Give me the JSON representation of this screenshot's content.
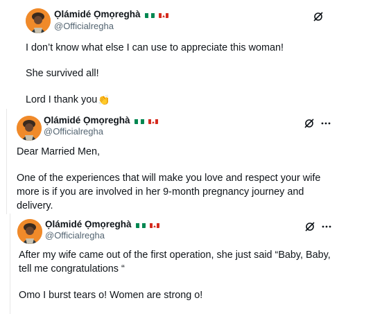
{
  "posts": [
    {
      "author": {
        "name": "Ọlámidé Ọmọreghà",
        "handle": "@Officialregha",
        "flags": [
          "nigeria-flag",
          "canada-flag"
        ]
      },
      "show_more": false,
      "lines": [
        "I don’t know what else I can use to appreciate this woman!",
        "She survived all!",
        "Lord I thank you"
      ],
      "emoji": "👏"
    },
    {
      "author": {
        "name": "Ọlámidé Ọmọreghà",
        "handle": "@Officialregha",
        "flags": [
          "nigeria-flag",
          "canada-flag"
        ]
      },
      "show_more": true,
      "lines": [
        "Dear Married Men,",
        "One of the experiences that will make you love and respect your wife",
        "more is if you are involved in her 9-month pregnancy  journey and",
        "delivery."
      ]
    },
    {
      "author": {
        "name": "Ọlámidé Ọmọreghà",
        "handle": "@Officialregha",
        "flags": [
          "nigeria-flag",
          "canada-flag"
        ]
      },
      "show_more": true,
      "lines": [
        "After my wife came out of the first operation, she just said “Baby, Baby,",
        "tell me congratulations “",
        "Omo I burst tears o! Women are strong o!"
      ]
    }
  ],
  "colors": {
    "avatar_bg": "#f08a2a",
    "handle": "#536471",
    "text": "#0f1419",
    "nigeria_green": "#008751",
    "canada_red": "#d52b1e"
  }
}
